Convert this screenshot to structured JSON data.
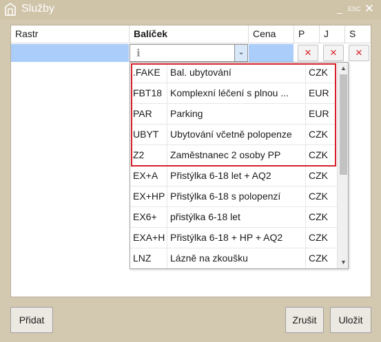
{
  "window": {
    "title": "Služby",
    "minimize_glyph": "_",
    "esc_label": "ESC",
    "close_glyph": "✕"
  },
  "grid": {
    "columns": [
      "Rastr",
      "Balíček",
      "Cena",
      "P",
      "J",
      "S"
    ],
    "edit_row": {
      "package_placeholder": "ℹ",
      "dropdown_glyph": "⌄",
      "remove_glyph": "✕"
    }
  },
  "dropdown": {
    "items": [
      {
        "code": ".FAKE",
        "name": "Bal. ubytování",
        "currency": "CZK"
      },
      {
        "code": "FBT18",
        "name": "Komplexní léčení s plnou ...",
        "currency": "EUR"
      },
      {
        "code": "PAR",
        "name": "Parking",
        "currency": "EUR"
      },
      {
        "code": "UBYT",
        "name": "Ubytování včetně polopenze",
        "currency": "CZK"
      },
      {
        "code": "Z2",
        "name": "Zaměstnanec 2 osoby PP",
        "currency": "CZK"
      },
      {
        "code": "EX+A",
        "name": "Přistýlka 6-18 let + AQ2",
        "currency": "CZK"
      },
      {
        "code": "EX+HP",
        "name": "Přistýlka 6-18 s polopenzí",
        "currency": "CZK"
      },
      {
        "code": "EX6+",
        "name": "přistýlka 6-18 let",
        "currency": "CZK"
      },
      {
        "code": "EXA+H",
        "name": "Přistýlka 6-18 + HP + AQ2",
        "currency": "CZK"
      },
      {
        "code": "LNZ",
        "name": "Lázně na zkoušku",
        "currency": "CZK"
      }
    ],
    "highlighted_rows": 5,
    "highlight_color": "#d81e2a"
  },
  "buttons": {
    "add": "Přidat",
    "cancel": "Zrušit",
    "save": "Uložit"
  },
  "colors": {
    "titlebar": "#cfc3a8",
    "selection": "#abcdf9",
    "remove_icon": "#d9262b"
  }
}
